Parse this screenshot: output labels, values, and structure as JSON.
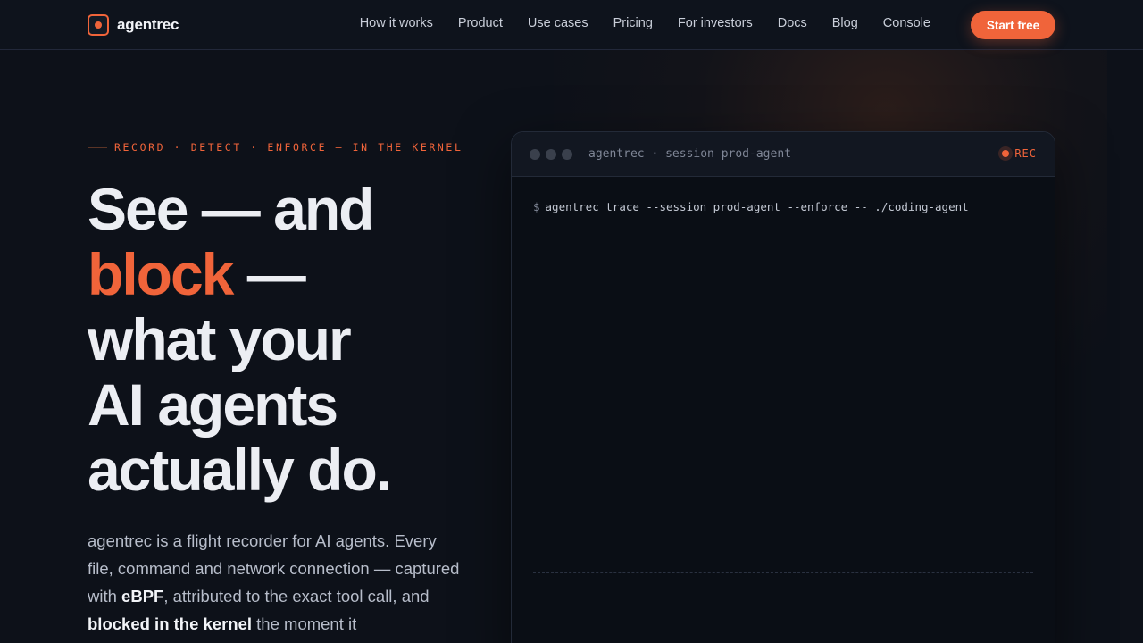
{
  "brand": {
    "name": "agentrec"
  },
  "nav": {
    "links": [
      "How it works",
      "Product",
      "Use cases",
      "Pricing",
      "For investors",
      "Docs",
      "Blog",
      "Console"
    ],
    "cta": "Start free"
  },
  "hero": {
    "eyebrow": "RECORD · DETECT · ENFORCE — IN THE KERNEL",
    "headline": {
      "line1": "See — and",
      "accent": "block",
      "line2_rest": " —",
      "line3": "what your",
      "line4": "AI agents",
      "line5": "actually do."
    },
    "lede": {
      "part1": "agentrec is a flight recorder for AI agents. Every file, command and network connection — captured with ",
      "bold1": "eBPF",
      "part2": ", attributed to the exact tool call, and ",
      "bold2": "blocked in the kernel",
      "part3": " the moment it"
    }
  },
  "terminal": {
    "title": "agentrec · session prod-agent",
    "rec_label": "REC",
    "prompt": "$",
    "command": "agentrec trace --session prod-agent --enforce -- ./coding-agent"
  },
  "colors": {
    "accent": "#f0643a",
    "background": "#0d1119"
  }
}
